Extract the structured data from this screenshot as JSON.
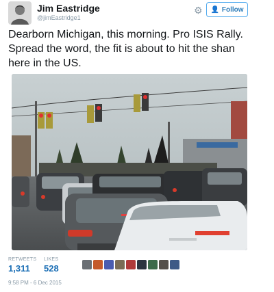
{
  "user": {
    "name": "Jim Eastridge",
    "handle": "@jimEastridge1"
  },
  "follow_label": "Follow",
  "tweet_text": "Dearborn Michigan, this morning. Pro ISIS Rally. Spread the word, the fit is about to hit the shan here in the US.",
  "stats": {
    "retweets_label": "RETWEETS",
    "retweets_count": "1,311",
    "likes_label": "LIKES",
    "likes_count": "528"
  },
  "timestamp": "9:58 PM - 6 Dec 2015",
  "icons": {
    "settings": "gear-icon",
    "follow": "add-user-icon"
  },
  "colors": {
    "accent": "#55acee",
    "count": "#1a6eb5",
    "muted": "#8899a6"
  }
}
